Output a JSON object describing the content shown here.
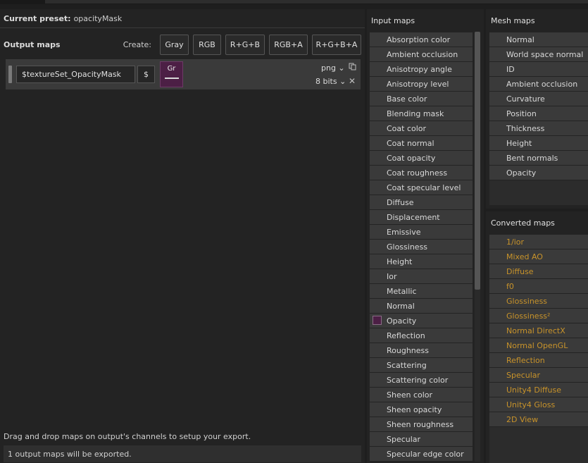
{
  "preset": {
    "label": "Current preset:",
    "value": "opacityMask"
  },
  "output": {
    "title": "Output maps",
    "create_label": "Create:",
    "create_buttons": [
      "Gray",
      "RGB",
      "R+G+B",
      "RGB+A",
      "R+G+B+A"
    ],
    "map": {
      "name": "$textureSet_OpacityMask",
      "dollar": "$",
      "channel": "Gr",
      "channel_color": "#4c1f45",
      "format": "png",
      "bits": "8 bits",
      "copy_icon": "copy-icon",
      "close_icon": "close-icon"
    },
    "hint": "Drag and drop maps on output's channels to setup your export.",
    "status": "1 output maps will be exported."
  },
  "input_maps": {
    "title": "Input maps",
    "items": [
      "Absorption color",
      "Ambient occlusion",
      "Anisotropy angle",
      "Anisotropy level",
      "Base color",
      "Blending mask",
      "Coat color",
      "Coat normal",
      "Coat opacity",
      "Coat roughness",
      "Coat specular level",
      "Diffuse",
      "Displacement",
      "Emissive",
      "Glossiness",
      "Height",
      "Ior",
      "Metallic",
      "Normal",
      "Opacity",
      "Reflection",
      "Roughness",
      "Scattering",
      "Scattering color",
      "Sheen color",
      "Sheen opacity",
      "Sheen roughness",
      "Specular",
      "Specular edge color"
    ],
    "selected": "Opacity"
  },
  "mesh_maps": {
    "title": "Mesh maps",
    "items": [
      "Normal",
      "World space normal",
      "ID",
      "Ambient occlusion",
      "Curvature",
      "Position",
      "Thickness",
      "Height",
      "Bent normals",
      "Opacity"
    ]
  },
  "converted_maps": {
    "title": "Converted maps",
    "accent": "#c8932a",
    "items": [
      "1/ior",
      "Mixed AO",
      "Diffuse",
      "f0",
      "Glossiness",
      "Glossiness²",
      "Normal DirectX",
      "Normal OpenGL",
      "Reflection",
      "Specular",
      "Unity4 Diffuse",
      "Unity4 Gloss",
      "2D View"
    ]
  }
}
